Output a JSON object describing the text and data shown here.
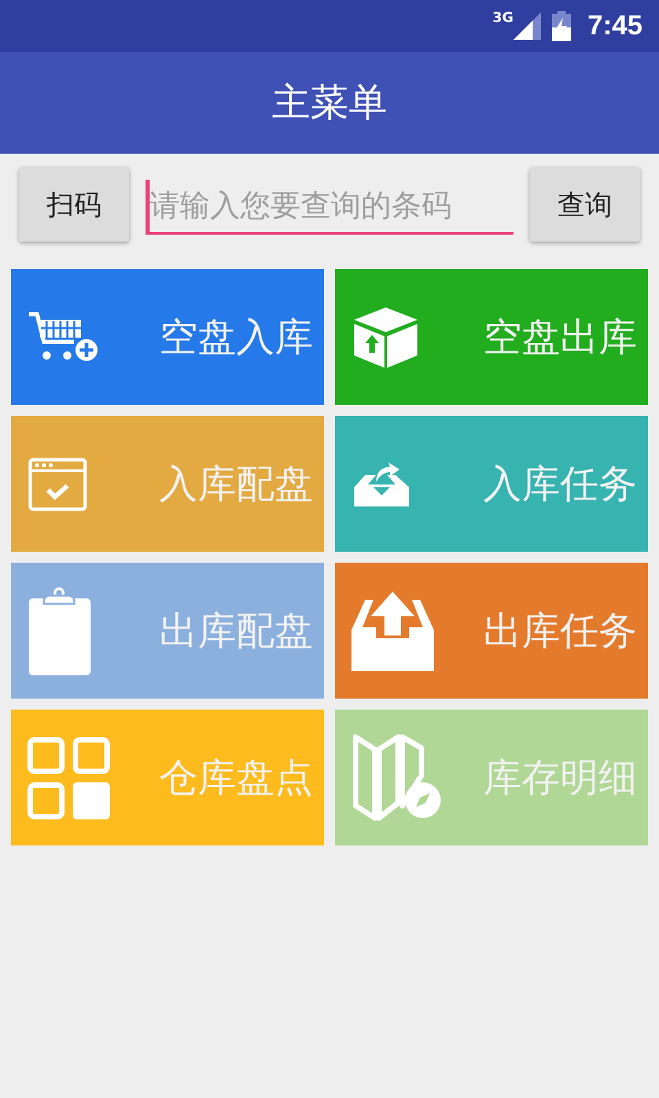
{
  "status_bar": {
    "network": "3G",
    "time": "7:45"
  },
  "app_bar": {
    "title": "主菜单"
  },
  "search": {
    "scan_button": "扫码",
    "placeholder": "请输入您要查询的条码",
    "query_button": "查询"
  },
  "tiles": [
    {
      "label": "空盘入库",
      "color": "#2579e8"
    },
    {
      "label": "空盘出库",
      "color": "#22ad1e"
    },
    {
      "label": "入库配盘",
      "color": "#e3aa42"
    },
    {
      "label": "入库任务",
      "color": "#37b3b0"
    },
    {
      "label": "出库配盘",
      "color": "#8cb0de"
    },
    {
      "label": "出库任务",
      "color": "#e47a2b"
    },
    {
      "label": "仓库盘点",
      "color": "#fdbb1d"
    },
    {
      "label": "库存明细",
      "color": "#b0d795"
    }
  ]
}
